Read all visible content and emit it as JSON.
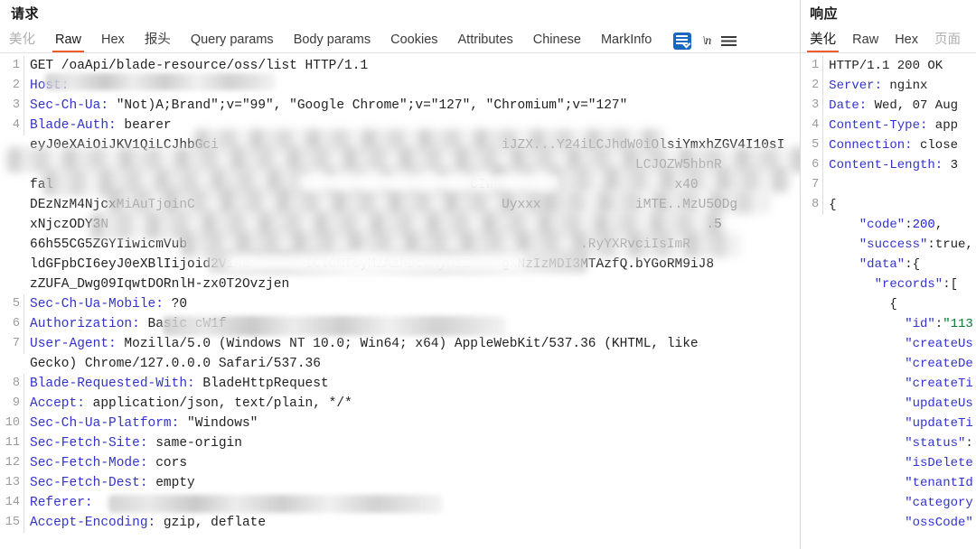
{
  "request": {
    "title": "请求",
    "tabs": [
      {
        "label": "美化",
        "state": "muted"
      },
      {
        "label": "Raw",
        "state": "active"
      },
      {
        "label": "Hex",
        "state": "normal"
      },
      {
        "label": "报头",
        "state": "normal"
      },
      {
        "label": "Query params",
        "state": "normal"
      },
      {
        "label": "Body params",
        "state": "normal"
      },
      {
        "label": "Cookies",
        "state": "normal"
      },
      {
        "label": "Attributes",
        "state": "normal"
      },
      {
        "label": "Chinese",
        "state": "normal"
      },
      {
        "label": "MarkInfo",
        "state": "normal"
      }
    ],
    "icons": [
      {
        "name": "wrap-lines-icon",
        "label": ""
      },
      {
        "name": "newline-icon",
        "label": "\\n"
      },
      {
        "name": "menu-icon",
        "label": ""
      }
    ],
    "lines": [
      {
        "num": "1",
        "key": "",
        "value": "GET /oaApi/blade-resource/oss/list HTTP/1.1"
      },
      {
        "num": "2",
        "key": "Host:",
        "value": ""
      },
      {
        "num": "3",
        "key": "Sec-Ch-Ua:",
        "value": " \"Not)A;Brand\";v=\"99\", \"Google Chrome\";v=\"127\", \"Chromium\";v=\"127\""
      },
      {
        "num": "4",
        "key": "Blade-Auth:",
        "value": " bearer"
      },
      {
        "num": "",
        "key": "",
        "value": "eyJ0eXAiOiJKV1QiLCJhbGci                                    iJZX...Y24iLCJhdW0iOlsiYmxhZGV4I10sI"
      },
      {
        "num": "",
        "key": "",
        "value": "                                                                             LCJOZW5hbnR"
      },
      {
        "num": "",
        "key": "",
        "value": "fal                                                     CIwM                      x40"
      },
      {
        "num": "",
        "key": "",
        "value": "DEzNzM4NjcxMiAuTjoinC                                       Uyxxx            iMTE..MzU5ODg"
      },
      {
        "num": "",
        "key": "",
        "value": "xNjczODY3N                                                                            .5"
      },
      {
        "num": "",
        "key": "",
        "value": "66h55CG5ZGYIiwicmVub                                                  .RyYXRvciIsImR"
      },
      {
        "num": "",
        "key": "",
        "value": "ldGFpbCI6eyJ0eXBlIijoid2Vine       ICIGMTcyMzAzMDcwMywiZ    gxNzIzMDI3MTAzfQ.bYGoRM9iJ8"
      },
      {
        "num": "",
        "key": "",
        "value": "zZUFA_Dwg09IqwtDORnlH-zx0T2Ovzjen"
      },
      {
        "num": "5",
        "key": "Sec-Ch-Ua-Mobile:",
        "value": " ?0"
      },
      {
        "num": "6",
        "key": "Authorization:",
        "value": " Basic cW1f"
      },
      {
        "num": "7",
        "key": "User-Agent:",
        "value": " Mozilla/5.0 (Windows NT 10.0; Win64; x64) AppleWebKit/537.36 (KHTML, like"
      },
      {
        "num": "",
        "key": "",
        "value": "Gecko) Chrome/127.0.0.0 Safari/537.36"
      },
      {
        "num": "8",
        "key": "Blade-Requested-With:",
        "value": " BladeHttpRequest"
      },
      {
        "num": "9",
        "key": "Accept:",
        "value": " application/json, text/plain, */*"
      },
      {
        "num": "10",
        "key": "Sec-Ch-Ua-Platform:",
        "value": " \"Windows\""
      },
      {
        "num": "11",
        "key": "Sec-Fetch-Site:",
        "value": " same-origin"
      },
      {
        "num": "12",
        "key": "Sec-Fetch-Mode:",
        "value": " cors"
      },
      {
        "num": "13",
        "key": "Sec-Fetch-Dest:",
        "value": " empty"
      },
      {
        "num": "14",
        "key": "Referer:",
        "value": " "
      },
      {
        "num": "15",
        "key": "Accept-Encoding:",
        "value": " gzip, deflate"
      }
    ]
  },
  "response": {
    "title": "响应",
    "tabs": [
      {
        "label": "美化",
        "state": "active"
      },
      {
        "label": "Raw",
        "state": "normal"
      },
      {
        "label": "Hex",
        "state": "normal"
      },
      {
        "label": "页面",
        "state": "muted"
      }
    ],
    "lines": [
      {
        "num": "1",
        "key": "",
        "value": "HTTP/1.1 200 OK"
      },
      {
        "num": "2",
        "key": "Server:",
        "value": " nginx"
      },
      {
        "num": "3",
        "key": "Date:",
        "value": " Wed, 07 Aug"
      },
      {
        "num": "4",
        "key": "Content-Type:",
        "value": " app"
      },
      {
        "num": "5",
        "key": "Connection:",
        "value": " close"
      },
      {
        "num": "6",
        "key": "Content-Length:",
        "value": " 3"
      },
      {
        "num": "7",
        "key": "",
        "value": ""
      },
      {
        "num": "8",
        "key": "",
        "value": "{"
      }
    ],
    "json_lines": [
      {
        "indent": 2,
        "key": "\"code\"",
        "sep": ":",
        "value": "200",
        "vtype": "num",
        "tail": ","
      },
      {
        "indent": 2,
        "key": "\"success\"",
        "sep": ":",
        "value": "true",
        "vtype": "pun",
        "tail": ","
      },
      {
        "indent": 2,
        "key": "\"data\"",
        "sep": ":",
        "value": "{",
        "vtype": "pun",
        "tail": ""
      },
      {
        "indent": 3,
        "key": "\"records\"",
        "sep": ":",
        "value": "[",
        "vtype": "pun",
        "tail": ""
      },
      {
        "indent": 4,
        "key": "",
        "sep": "",
        "value": "{",
        "vtype": "pun",
        "tail": ""
      },
      {
        "indent": 5,
        "key": "\"id\"",
        "sep": ":",
        "value": "\"113",
        "vtype": "str",
        "tail": ""
      },
      {
        "indent": 5,
        "key": "\"createUs",
        "sep": "",
        "value": "",
        "vtype": "pun",
        "tail": ""
      },
      {
        "indent": 5,
        "key": "\"createDe",
        "sep": "",
        "value": "",
        "vtype": "pun",
        "tail": ""
      },
      {
        "indent": 5,
        "key": "\"createTi",
        "sep": "",
        "value": "",
        "vtype": "pun",
        "tail": ""
      },
      {
        "indent": 5,
        "key": "\"updateUs",
        "sep": "",
        "value": "",
        "vtype": "pun",
        "tail": ""
      },
      {
        "indent": 5,
        "key": "\"updateTi",
        "sep": "",
        "value": "",
        "vtype": "pun",
        "tail": ""
      },
      {
        "indent": 5,
        "key": "\"status\"",
        "sep": ":",
        "value": "",
        "vtype": "pun",
        "tail": ""
      },
      {
        "indent": 5,
        "key": "\"isDelete",
        "sep": "",
        "value": "",
        "vtype": "pun",
        "tail": ""
      },
      {
        "indent": 5,
        "key": "\"tenantId",
        "sep": "",
        "value": "",
        "vtype": "pun",
        "tail": ""
      },
      {
        "indent": 5,
        "key": "\"category",
        "sep": "",
        "value": "",
        "vtype": "pun",
        "tail": ""
      },
      {
        "indent": 5,
        "key": "\"ossCode\"",
        "sep": "",
        "value": "",
        "vtype": "pun",
        "tail": ""
      }
    ]
  },
  "colors": {
    "accent": "#f05a28",
    "header_key": "#3333cc",
    "json_string": "#0a7a32",
    "json_number": "#2222dd",
    "icon_active_bg": "#1769c0",
    "gutter_text": "#9b9b9b"
  }
}
